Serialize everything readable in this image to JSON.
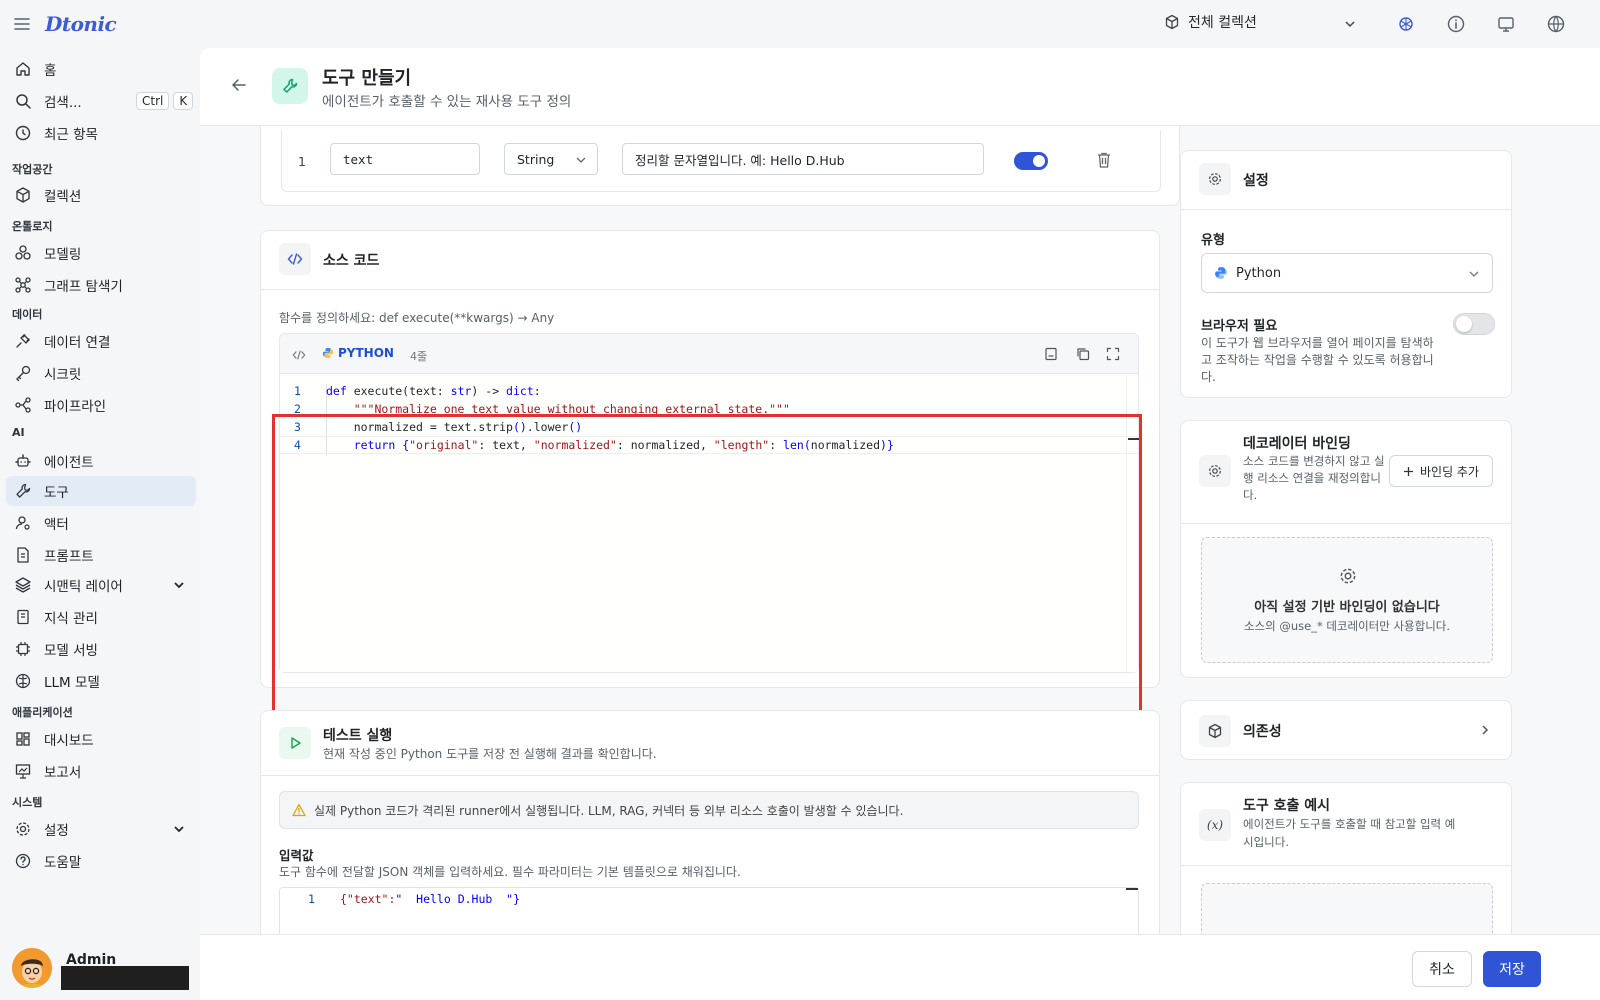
{
  "topbar": {
    "brand": "Dtonic",
    "collection_selector": "전체 컬렉션"
  },
  "sidebar": {
    "items_top": [
      {
        "label": "홈",
        "icon": "home-icon"
      },
      {
        "label": "검색...",
        "icon": "search-icon",
        "shortcut": [
          "Ctrl",
          "K"
        ]
      },
      {
        "label": "최근 항목",
        "icon": "clock-icon"
      }
    ],
    "sections": {
      "workspace": "작업공간",
      "ontology": "온톨로지",
      "data": "데이터",
      "ai": "AI",
      "apps": "애플리케이션",
      "system": "시스템"
    },
    "items": {
      "collection": "컬렉션",
      "modeling": "모델링",
      "graph": "그래프 탐색기",
      "data_conn": "데이터 연결",
      "secret": "시크릿",
      "pipeline": "파이프라인",
      "agent": "에이전트",
      "tool": "도구",
      "actor": "액터",
      "prompt": "프롬프트",
      "semantic": "시맨틱 레이어",
      "knowledge": "지식 관리",
      "model_serving": "모델 서빙",
      "llm": "LLM 모델",
      "dashboard": "대시보드",
      "report": "보고서",
      "settings": "설정",
      "help": "도움말"
    },
    "user": {
      "name": "Admin"
    }
  },
  "header": {
    "title": "도구 만들기",
    "subtitle": "에이전트가 호출할 수 있는 재사용 도구 정의"
  },
  "params": {
    "row_index": "1",
    "name": "text",
    "type": "String",
    "description": "정리할 문자열입니다. 예:  Hello D.Hub",
    "required": true
  },
  "source": {
    "title": "소스 코드",
    "hint": "함수를 정의하세요: def execute(**kwargs) → Any",
    "lang": "PYTHON",
    "line_count": "4줄"
  },
  "test": {
    "title": "테스트 실행",
    "subtitle": "현재 작성 중인 Python 도구를 저장 전 실행해 결과를 확인합니다.",
    "warning": "실제 Python 코드가 격리된 runner에서 실행됩니다. LLM, RAG, 커넥터 등 외부 리소스 호출이 발생할 수 있습니다.",
    "input_label": "입력값",
    "input_hint": "도구 함수에 전달할 JSON 객체를 입력하세요. 필수 파라미터는 기본 템플릿으로 채워집니다.",
    "input_line": "1",
    "input_value_key": "{\"text\":",
    "input_value_val": "\"  Hello D.Hub  \"}"
  },
  "settings": {
    "title": "설정",
    "type_label": "유형",
    "type_value": "Python",
    "browser_label": "브라우저 필요",
    "browser_desc": "이 도구가 웹 브라우저를 열어 페이지를 탐색하고 조작하는 작업을 수행할 수 있도록 허용합니다.",
    "browser_enabled": false
  },
  "decorator": {
    "title": "데코레이터 바인딩",
    "desc": "소스 코드를 변경하지 않고 실행 리소스 연결을 재정의합니다.",
    "add_btn": "바인딩 추가",
    "empty_title": "아직 설정 기반 바인딩이 없습니다",
    "empty_desc": "소스의 @use_* 데코레이터만 사용합니다."
  },
  "deps": {
    "title": "의존성"
  },
  "example": {
    "title": "도구 호출 예시",
    "desc": "에이전트가 도구를 호출할 때 참고할 입력 예시입니다."
  },
  "footer": {
    "cancel": "취소",
    "save": "저장"
  },
  "colors": {
    "accent": "#3b5bdb",
    "primary_button": "#2f54d6",
    "highlight_border": "#e5312b",
    "teal_icon_bg": "#d3f6ea"
  }
}
